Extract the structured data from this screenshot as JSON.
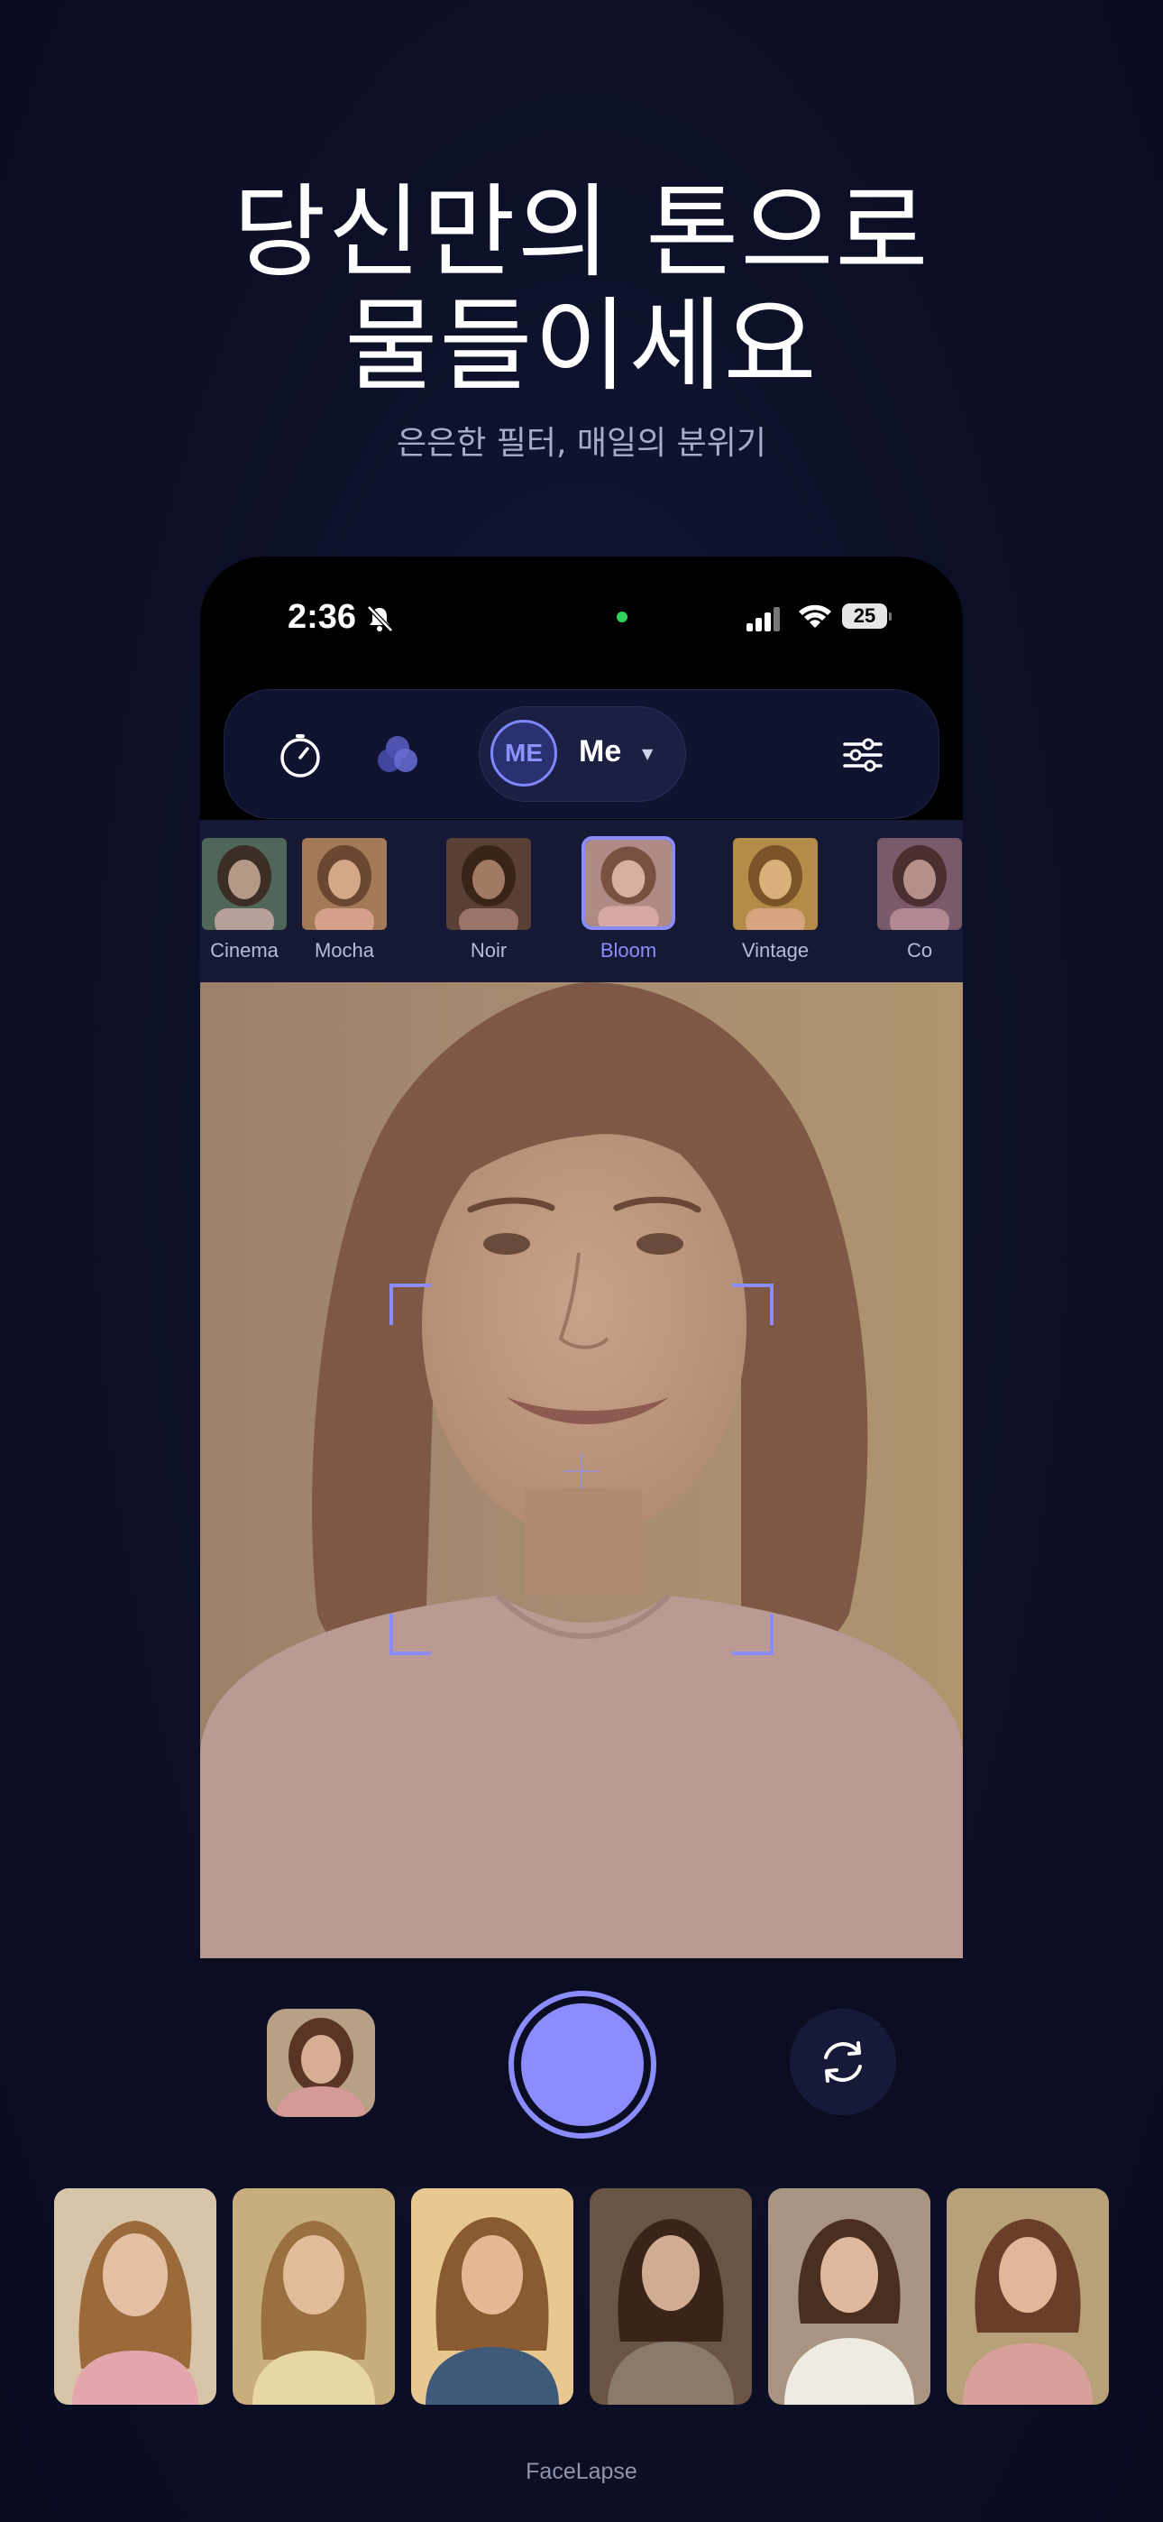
{
  "promo": {
    "headline_line1": "당신만의 톤으로",
    "headline_line2": "물들이세요",
    "subheadline": "은은한 필터, 매일의 분위기"
  },
  "status_bar": {
    "time": "2:36",
    "battery": "25"
  },
  "toolbar": {
    "timer_icon": "timer-icon",
    "filters_icon": "color-filter-icon",
    "profile_initials": "ME",
    "profile_name": "Me",
    "settings_icon": "sliders-icon"
  },
  "filters": [
    {
      "label": "Cinema",
      "tint": "#5e7a6a",
      "selected": false
    },
    {
      "label": "Mocha",
      "tint": "#a87a5c",
      "selected": false
    },
    {
      "label": "Noir",
      "tint": "#6a4a3a",
      "selected": false
    },
    {
      "label": "Bloom",
      "tint": "#c08a86",
      "selected": true
    },
    {
      "label": "Vintage",
      "tint": "#b8904e",
      "selected": false
    },
    {
      "label": "Co",
      "tint": "#8a6a7a",
      "selected": false
    }
  ],
  "camera": {
    "accent_color": "#8b8dff"
  },
  "controls": {
    "shutter_icon": "shutter-button",
    "flip_icon": "flip-camera-icon"
  },
  "footer": {
    "app_name": "FaceLapse"
  }
}
